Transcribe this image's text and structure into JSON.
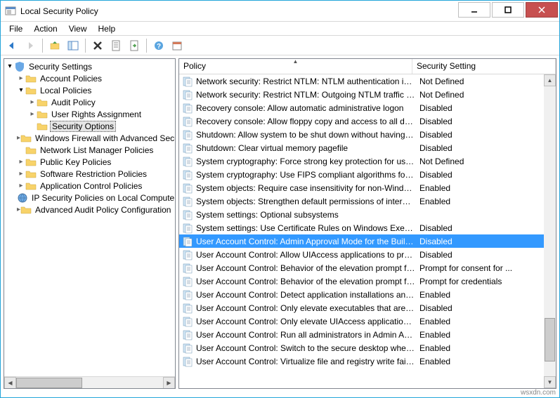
{
  "window": {
    "title": "Local Security Policy"
  },
  "menu": {
    "file": "File",
    "action": "Action",
    "view": "View",
    "help": "Help"
  },
  "tree": {
    "root": "Security Settings",
    "items": [
      {
        "label": "Account Policies"
      },
      {
        "label": "Local Policies"
      },
      {
        "label": "Audit Policy"
      },
      {
        "label": "User Rights Assignment"
      },
      {
        "label": "Security Options"
      },
      {
        "label": "Windows Firewall with Advanced Secu"
      },
      {
        "label": "Network List Manager Policies"
      },
      {
        "label": "Public Key Policies"
      },
      {
        "label": "Software Restriction Policies"
      },
      {
        "label": "Application Control Policies"
      },
      {
        "label": "IP Security Policies on Local Compute"
      },
      {
        "label": "Advanced Audit Policy Configuration"
      }
    ]
  },
  "columns": {
    "policy": "Policy",
    "setting": "Security Setting"
  },
  "policies": [
    {
      "name": "Network security: Restrict NTLM: NTLM authentication in th...",
      "setting": "Not Defined"
    },
    {
      "name": "Network security: Restrict NTLM: Outgoing NTLM traffic to ...",
      "setting": "Not Defined"
    },
    {
      "name": "Recovery console: Allow automatic administrative logon",
      "setting": "Disabled"
    },
    {
      "name": "Recovery console: Allow floppy copy and access to all drives...",
      "setting": "Disabled"
    },
    {
      "name": "Shutdown: Allow system to be shut down without having to...",
      "setting": "Disabled"
    },
    {
      "name": "Shutdown: Clear virtual memory pagefile",
      "setting": "Disabled"
    },
    {
      "name": "System cryptography: Force strong key protection for user k...",
      "setting": "Not Defined"
    },
    {
      "name": "System cryptography: Use FIPS compliant algorithms for en...",
      "setting": "Disabled"
    },
    {
      "name": "System objects: Require case insensitivity for non-Windows ...",
      "setting": "Enabled"
    },
    {
      "name": "System objects: Strengthen default permissions of internal s...",
      "setting": "Enabled"
    },
    {
      "name": "System settings: Optional subsystems",
      "setting": ""
    },
    {
      "name": "System settings: Use Certificate Rules on Windows Executabl...",
      "setting": "Disabled"
    },
    {
      "name": "User Account Control: Admin Approval Mode for the Built-i...",
      "setting": "Disabled"
    },
    {
      "name": "User Account Control: Allow UIAccess applications to prom...",
      "setting": "Disabled"
    },
    {
      "name": "User Account Control: Behavior of the elevation prompt for ...",
      "setting": "Prompt for consent for ..."
    },
    {
      "name": "User Account Control: Behavior of the elevation prompt for ...",
      "setting": "Prompt for credentials"
    },
    {
      "name": "User Account Control: Detect application installations and p...",
      "setting": "Enabled"
    },
    {
      "name": "User Account Control: Only elevate executables that are sign...",
      "setting": "Disabled"
    },
    {
      "name": "User Account Control: Only elevate UIAccess applications th...",
      "setting": "Enabled"
    },
    {
      "name": "User Account Control: Run all administrators in Admin Appr...",
      "setting": "Enabled"
    },
    {
      "name": "User Account Control: Switch to the secure desktop when pr...",
      "setting": "Enabled"
    },
    {
      "name": "User Account Control: Virtualize file and registry write failure...",
      "setting": "Enabled"
    }
  ],
  "watermark": "wsxdn.com"
}
